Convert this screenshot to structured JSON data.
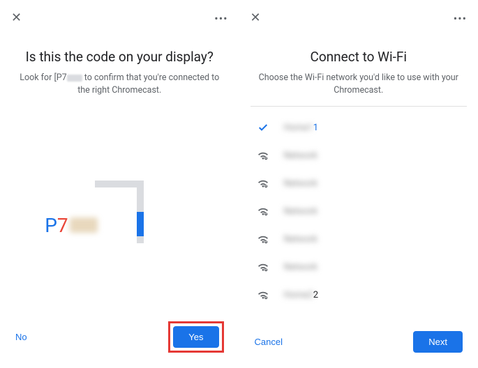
{
  "left": {
    "title": "Is this the code on your display?",
    "subtitle_prefix": "Look for [P7",
    "subtitle_suffix": " to confirm that you're connected to the right Chromecast.",
    "code_char1": "P",
    "code_char2": "7",
    "no_label": "No",
    "yes_label": "Yes"
  },
  "right": {
    "title": "Connect to Wi-Fi",
    "subtitle": "Choose the Wi-Fi network you'd like to use with your Chromecast.",
    "networks": [
      {
        "name": "Home1",
        "suffix": "1",
        "selected": true
      },
      {
        "name": "Network",
        "suffix": "",
        "selected": false
      },
      {
        "name": "Network",
        "suffix": "",
        "selected": false
      },
      {
        "name": "Network",
        "suffix": "",
        "selected": false
      },
      {
        "name": "Network",
        "suffix": "",
        "selected": false
      },
      {
        "name": "Network",
        "suffix": "",
        "selected": false
      },
      {
        "name": "Home2",
        "suffix": "2",
        "selected": false
      }
    ],
    "cancel_label": "Cancel",
    "next_label": "Next"
  }
}
